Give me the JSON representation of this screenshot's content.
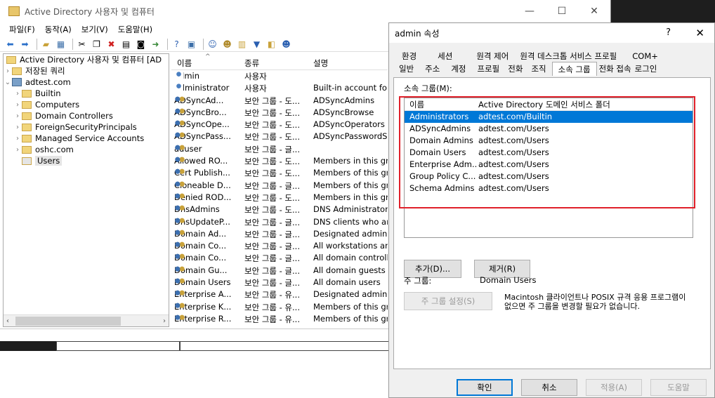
{
  "main_window": {
    "title": "Active Directory 사용자 및 컴퓨터",
    "menu": [
      "파일(F)",
      "동작(A)",
      "보기(V)",
      "도움말(H)"
    ]
  },
  "tree": {
    "root": "Active Directory 사용자 및 컴퓨터 [AD",
    "saved_queries": "저장된 쿼리",
    "domain": "adtest.com",
    "children": [
      "Builtin",
      "Computers",
      "Domain Controllers",
      "ForeignSecurityPrincipals",
      "Managed Service Accounts",
      "oshc.com",
      "Users"
    ]
  },
  "list": {
    "headers": [
      "이름",
      "종류",
      "설명"
    ],
    "rows": [
      {
        "icon": "user",
        "name": "admin",
        "type": "사용자",
        "desc": ""
      },
      {
        "icon": "user",
        "name": "Administrator",
        "type": "사용자",
        "desc": "Built-in account for"
      },
      {
        "icon": "group",
        "name": "ADSyncAd...",
        "type": "보안 그룹 - 도...",
        "desc": "ADSyncAdmins"
      },
      {
        "icon": "group",
        "name": "ADSyncBro...",
        "type": "보안 그룹 - 도...",
        "desc": "ADSyncBrowse"
      },
      {
        "icon": "group",
        "name": "ADSyncOpe...",
        "type": "보안 그룹 - 도...",
        "desc": "ADSyncOperators"
      },
      {
        "icon": "group",
        "name": "ADSyncPass...",
        "type": "보안 그룹 - 도...",
        "desc": "ADSyncPasswordSet"
      },
      {
        "icon": "group",
        "name": "aduser",
        "type": "보안 그룹 - 글...",
        "desc": ""
      },
      {
        "icon": "group",
        "name": "Allowed RO...",
        "type": "보안 그룹 - 도...",
        "desc": "Members in this gro"
      },
      {
        "icon": "group",
        "name": "Cert Publish...",
        "type": "보안 그룹 - 도...",
        "desc": "Members of this gro"
      },
      {
        "icon": "group",
        "name": "Cloneable D...",
        "type": "보안 그룹 - 글...",
        "desc": "Members of this gro"
      },
      {
        "icon": "group",
        "name": "Denied ROD...",
        "type": "보안 그룹 - 도...",
        "desc": "Members in this gro"
      },
      {
        "icon": "group",
        "name": "DnsAdmins",
        "type": "보안 그룹 - 도...",
        "desc": "DNS Administrators"
      },
      {
        "icon": "group",
        "name": "DnsUpdateP...",
        "type": "보안 그룹 - 글...",
        "desc": "DNS clients who are"
      },
      {
        "icon": "group",
        "name": "Domain Ad...",
        "type": "보안 그룹 - 글...",
        "desc": "Designated administ"
      },
      {
        "icon": "group",
        "name": "Domain Co...",
        "type": "보안 그룹 - 글...",
        "desc": "All workstations and"
      },
      {
        "icon": "group",
        "name": "Domain Co...",
        "type": "보안 그룹 - 글...",
        "desc": "All domain controlle"
      },
      {
        "icon": "group",
        "name": "Domain Gu...",
        "type": "보안 그룹 - 글...",
        "desc": "All domain guests"
      },
      {
        "icon": "group",
        "name": "Domain Users",
        "type": "보안 그룹 - 글...",
        "desc": "All domain users"
      },
      {
        "icon": "group",
        "name": "Enterprise A...",
        "type": "보안 그룹 - 유...",
        "desc": "Designated administ"
      },
      {
        "icon": "group",
        "name": "Enterprise K...",
        "type": "보안 그룹 - 유...",
        "desc": "Members of this gro"
      },
      {
        "icon": "group",
        "name": "Enterprise R...",
        "type": "보안 그룹 - 유...",
        "desc": "Members of this gro"
      }
    ]
  },
  "dialog": {
    "title": "admin 속성",
    "help": "?",
    "close": "✕",
    "tabs_row1": [
      "환경",
      "세션",
      "원격 제어",
      "원격 데스크톱 서비스 프로필",
      "COM+"
    ],
    "tabs_row2": [
      "일반",
      "주소",
      "계정",
      "프로필",
      "전화",
      "조직",
      "소속 그룹",
      "전화 접속",
      "로그인"
    ],
    "active_tab": "소속 그룹",
    "member_of_label": "소속 그룹(M):",
    "member_headers": [
      "이름",
      "Active Directory 도메인 서비스 폴더"
    ],
    "members": [
      {
        "name": "Administrators",
        "folder": "adtest.com/Builtin"
      },
      {
        "name": "ADSyncAdmins",
        "folder": "adtest.com/Users"
      },
      {
        "name": "Domain Admins",
        "folder": "adtest.com/Users"
      },
      {
        "name": "Domain Users",
        "folder": "adtest.com/Users"
      },
      {
        "name": "Enterprise Adm...",
        "folder": "adtest.com/Users"
      },
      {
        "name": "Group Policy C...",
        "folder": "adtest.com/Users"
      },
      {
        "name": "Schema Admins",
        "folder": "adtest.com/Users"
      }
    ],
    "add_button": "추가(D)...",
    "remove_button": "제거(R)",
    "primary_group_label": "주 그룹:",
    "primary_group_value": "Domain Users",
    "set_primary_button": "주 그룹 설정(S)",
    "note": "Macintosh 클라이언트나 POSIX 규격 응용 프로그램이 없으면 주 그룹을 변경할 필요가 없습니다.",
    "ok_button": "확인",
    "cancel_button": "취소",
    "apply_button": "적용(A)",
    "help_button": "도움말"
  }
}
